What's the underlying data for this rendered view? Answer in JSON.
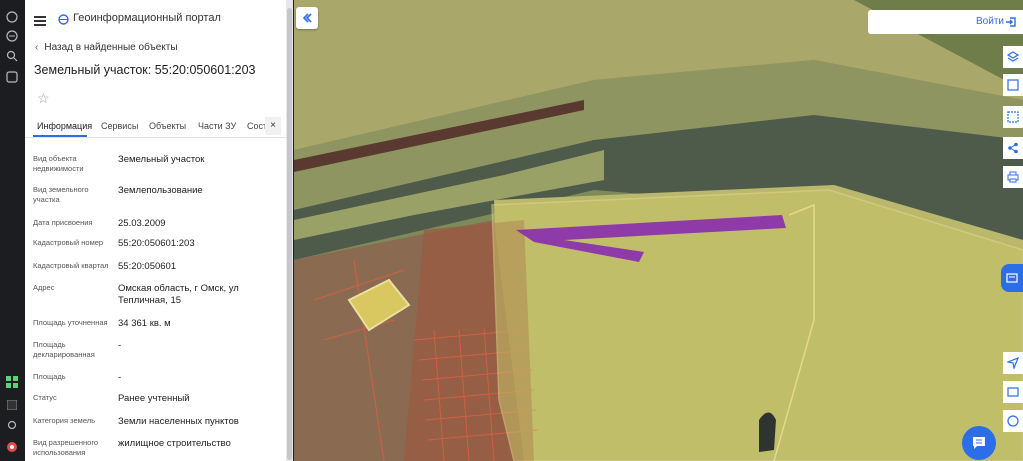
{
  "header": {
    "portal_title": "Геоинформационный портал"
  },
  "panel": {
    "back_label": "Назад в найденные объекты",
    "title": "Земельный участок: 55:20:050601:203",
    "tabs": [
      "Информация",
      "Сервисы",
      "Объекты",
      "Части ЗУ",
      "Сост"
    ],
    "fields": [
      {
        "label": "Вид объекта недвижимости",
        "value": "Земельный участок"
      },
      {
        "label": "Вид земельного участка",
        "value": "Землепользование"
      },
      {
        "label": "Дата присвоения",
        "value": "25.03.2009"
      },
      {
        "label": "Кадастровый номер",
        "value": "55:20:050601:203"
      },
      {
        "label": "Кадастровый квартал",
        "value": "55:20:050601"
      },
      {
        "label": "Адрес",
        "value": "Омская область, г Омск, ул Тепличная, 15"
      },
      {
        "label": "Площадь уточненная",
        "value": "34 361 кв. м"
      },
      {
        "label": "Площадь декларированная",
        "value": "-"
      },
      {
        "label": "Площадь",
        "value": "-"
      },
      {
        "label": "Статус",
        "value": "Ранее учтенный"
      },
      {
        "label": "Категория земель",
        "value": "Земли населенных пунктов"
      },
      {
        "label": "Вид разрешенного использования",
        "value": "жилищное строительство"
      }
    ]
  },
  "map": {
    "login_label": "Войти"
  },
  "colors": {
    "accent": "#2c6ee8",
    "parcel_highlight": "#8a2bb0",
    "parcel_fill": "#c8c46a",
    "cadastre_lines": "#d86040"
  },
  "icons": {
    "leftbar": [
      "settings-icon",
      "layers-icon",
      "search-icon",
      "grid-icon",
      "apps-icon",
      "k-icon",
      "link-icon",
      "location-icon"
    ],
    "tools": [
      "layers-icon",
      "select-icon",
      "share-icon",
      "print-icon",
      "measure-icon",
      "navigate-icon",
      "legend-icon",
      "info-icon"
    ]
  }
}
